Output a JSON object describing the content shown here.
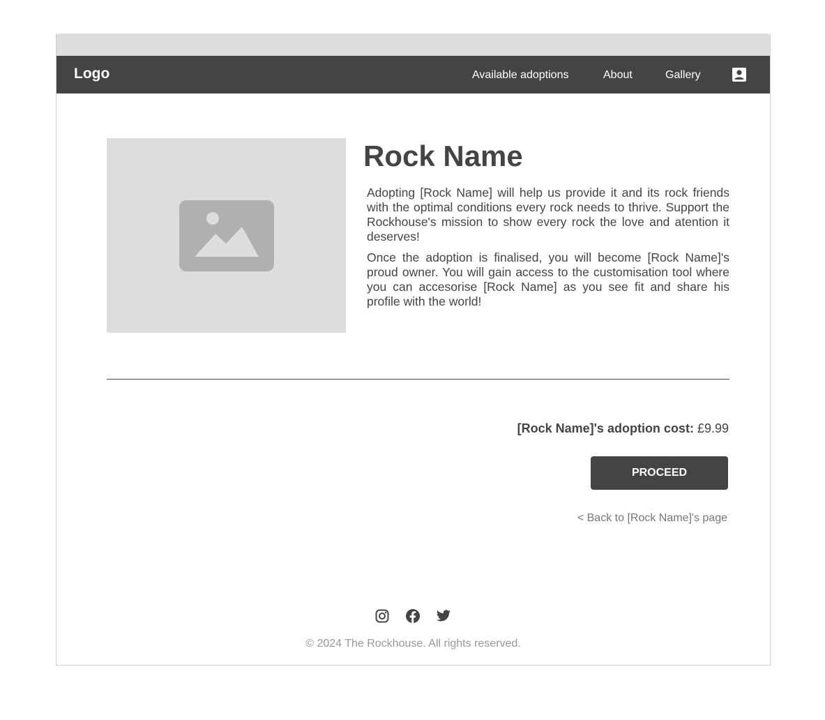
{
  "nav": {
    "logo": "Logo",
    "links": [
      "Available adoptions",
      "About",
      "Gallery"
    ],
    "account_icon": "account-box-icon"
  },
  "main": {
    "image_icon": "image-placeholder-icon",
    "title": "Rock Name",
    "paragraphs": [
      "Adopting [Rock Name] will help us provide it and its rock friends with the optimal conditions every rock needs to thrive. Support the Rockhouse's mission to show every rock the love and atention it deserves!",
      "Once the adoption is finalised, you will become [Rock Name]'s proud owner. You will gain access to the customisation tool where you can accesorise [Rock Name] as you see fit and share his profile with the world!"
    ],
    "cost_label": "[Rock Name]'s adoption cost:",
    "cost_value": "£9.99",
    "proceed_label": "PROCEED",
    "back_link": "< Back to [Rock Name]'s page"
  },
  "footer": {
    "social_icons": [
      "instagram-icon",
      "facebook-icon",
      "twitter-icon"
    ],
    "copyright": "© 2024 The Rockhouse. All rights reserved."
  },
  "colors": {
    "dark": "#444444",
    "placeholder": "#dddddd",
    "placeholder_icon": "#b0b0b0",
    "muted_text": "#777777",
    "footer_text": "#999999"
  }
}
